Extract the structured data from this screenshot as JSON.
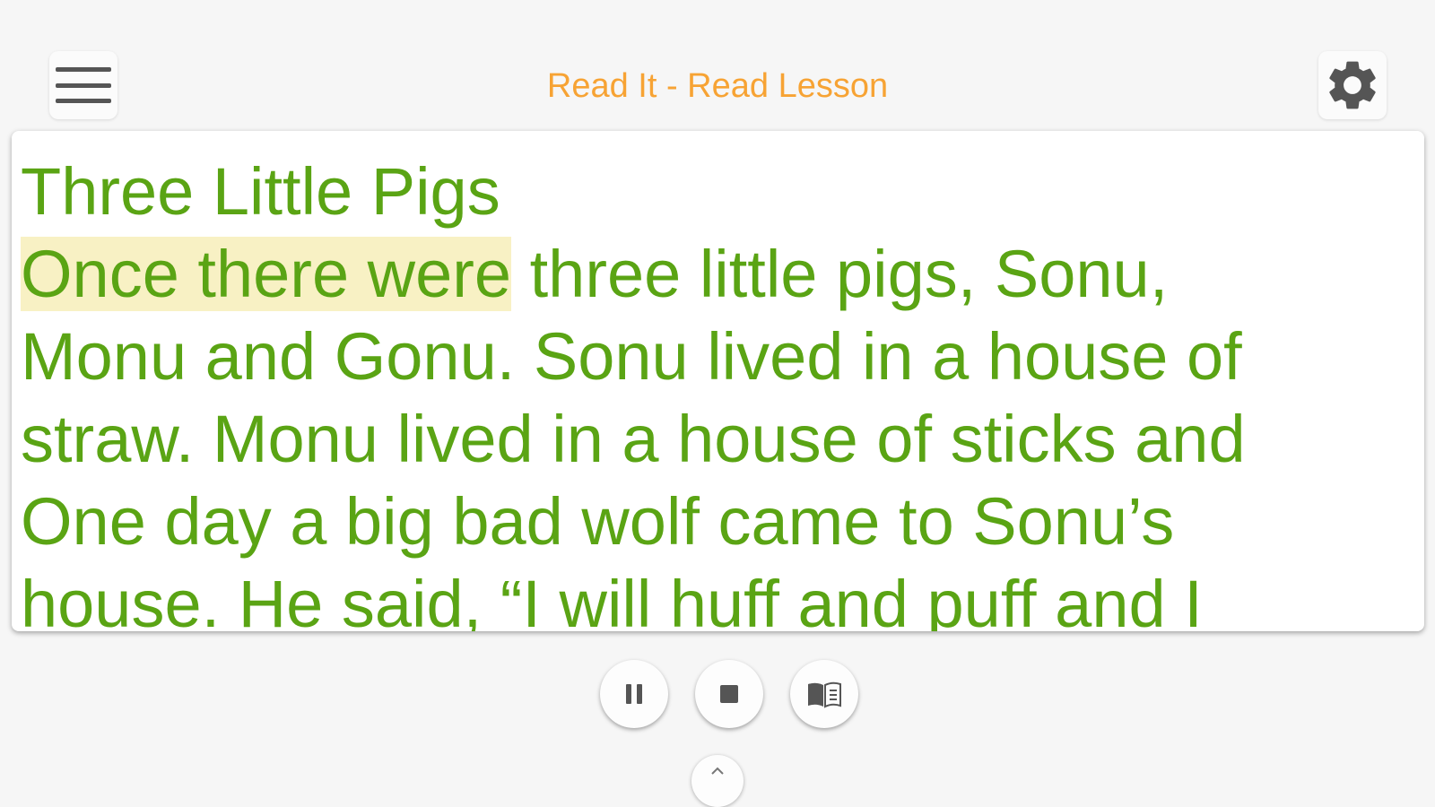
{
  "header": {
    "title": "Read It - Read Lesson",
    "menu_icon": "hamburger-menu-icon",
    "settings_icon": "gear-icon",
    "title_color": "#f7a334"
  },
  "lesson": {
    "heading": "Three Little Pigs",
    "highlighted_phrase": "Once there were",
    "line1_rest": " three little pigs, Sonu,",
    "line2": "Monu and Gonu. Sonu lived in a house of",
    "line3": "straw. Monu lived in a house of sticks and",
    "line4": "One day a big bad wolf came to Sonu’s",
    "line5": "house. He said, “I will huff and puff and I",
    "text_color": "#5aa414",
    "highlight_color": "#f8f1c4"
  },
  "controls": {
    "pause_icon": "pause-icon",
    "stop_icon": "stop-icon",
    "book_icon": "reading-book-icon",
    "expand_icon": "chevron-up-icon"
  }
}
